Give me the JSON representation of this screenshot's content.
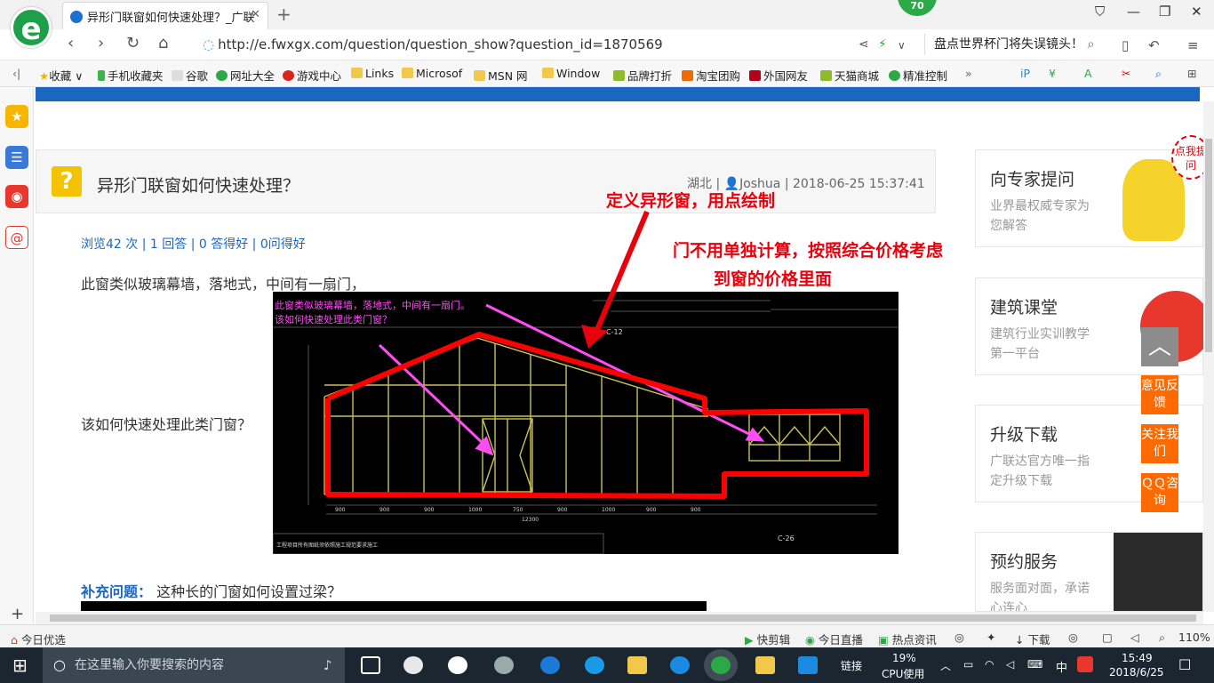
{
  "browser": {
    "tab_title": "异形门联窗如何快速处理？_广联",
    "badge": "70",
    "url": "http://e.fwxgx.com/question/question_show?question_id=1870569",
    "search_text": "盘点世界杯门将失误镜头！",
    "bookmarks": [
      "收藏",
      "手机收藏夹",
      "谷歌",
      "网址大全",
      "游戏中心",
      "Links",
      "Microsof",
      "MSN 网",
      "Window",
      "品牌打折",
      "淘宝团购",
      "外国网友",
      "天猫商城",
      "精准控制"
    ]
  },
  "question": {
    "title": "异形门联窗如何快速处理？",
    "location": "湖北",
    "user": "Joshua",
    "datetime": "2018-06-25 15:37:41",
    "stats": "浏览42 次 | 1 回答 | 0 答得好 | 0问得好",
    "para1": "此窗类似玻璃幕墙，落地式，中间有一扇门，",
    "para2": "该如何快速处理此类门窗？",
    "supplement_label": "补充问题：",
    "supplement_text": "这种长的门窗如何设置过梁？"
  },
  "image_annotations": {
    "cad_note_line1": "此窗类似玻璃幕墙，落地式，中间有一扇门。",
    "cad_note_line2": "该如何快速处理此类门窗？",
    "red1": "定义异形窗，用点绘制",
    "red2": "门不用单独计算，按照综合价格考虑",
    "red3": "到窗的价格里面"
  },
  "right_panel": [
    {
      "title": "向专家提问",
      "sub": "业界最权威专家为您解答"
    },
    {
      "title": "建筑课堂",
      "sub": "建筑行业实训教学第一平台"
    },
    {
      "title": "升级下载",
      "sub": "广联达官方唯一指定升级下载"
    },
    {
      "title": "预约服务",
      "sub": "服务面对面，承诺心连心"
    }
  ],
  "float_buttons": {
    "feedback": "意见反馈",
    "follow": "关注我们",
    "qq": "ＱＱ咨询"
  },
  "mascot_text": "点我提问",
  "statusbar": {
    "left": "今日优选",
    "items": [
      "快剪辑",
      "今日直播",
      "热点资讯",
      "下载"
    ],
    "zoom": "110%"
  },
  "taskbar": {
    "search_placeholder": "在这里输入你要搜索的内容",
    "link": "链接",
    "cpu": "19%",
    "cpu_label": "CPU使用",
    "ime": "中",
    "time": "15:49",
    "date": "2018/6/25"
  },
  "colors": {
    "accent": "#1a67c0",
    "annotation_red": "#e8000c",
    "orange": "#ff6a00"
  }
}
